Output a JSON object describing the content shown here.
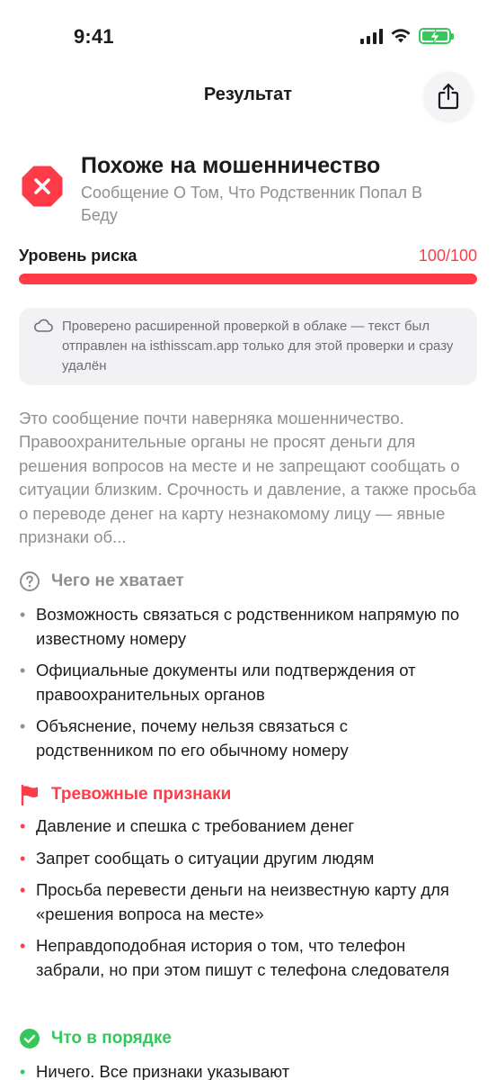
{
  "status_bar": {
    "time": "9:41"
  },
  "nav": {
    "title": "Результат"
  },
  "verdict": {
    "title": "Похоже на мошенничество",
    "subtitle": "Сообщение О Том, Что Родственник Попал В Беду"
  },
  "risk": {
    "label": "Уровень риска",
    "value_text": "100/100",
    "level_percent": 100
  },
  "cloud_notice": {
    "text": "Проверено расширенной проверкой в облаке — текст был отправлен на isthisscam.app только для этой проверки и сразу удалён"
  },
  "summary": "Это сообщение почти наверняка мошенничество. Правоохранительные органы не просят деньги для решения вопросов на месте и не запрещают сообщать о ситуации близким. Срочность и давление, а также просьба о переводе денег на карту незнакомому лицу — явные признаки об...",
  "missing": {
    "title": "Чего не хватает",
    "items": [
      "Возможность связаться с родственником напрямую по известному номеру",
      "Официальные документы или подтверждения от правоохранительных органов",
      "Объяснение, почему нельзя связаться с родственником по его обычному номеру"
    ]
  },
  "red_flags": {
    "title": "Тревожные признаки",
    "items": [
      "Давление и спешка с требованием денег",
      "Запрет сообщать о ситуации другим людям",
      "Просьба перевести деньги на неизвестную карту для «решения вопроса на месте»",
      "Неправдоподобная история о том, что телефон забрали, но при этом пишут с телефона следователя"
    ]
  },
  "ok": {
    "title": "Что в порядке",
    "items": [
      "Ничего. Все признаки указывают"
    ]
  },
  "colors": {
    "danger": "#ff3b47",
    "success": "#34c759",
    "muted": "#8e8e93"
  },
  "icons": {
    "share": "share-icon",
    "verdict": "stop-x-icon",
    "cloud": "cloud-icon",
    "missing": "question-circle-icon",
    "red_flags": "flag-icon",
    "ok": "check-circle-icon"
  }
}
